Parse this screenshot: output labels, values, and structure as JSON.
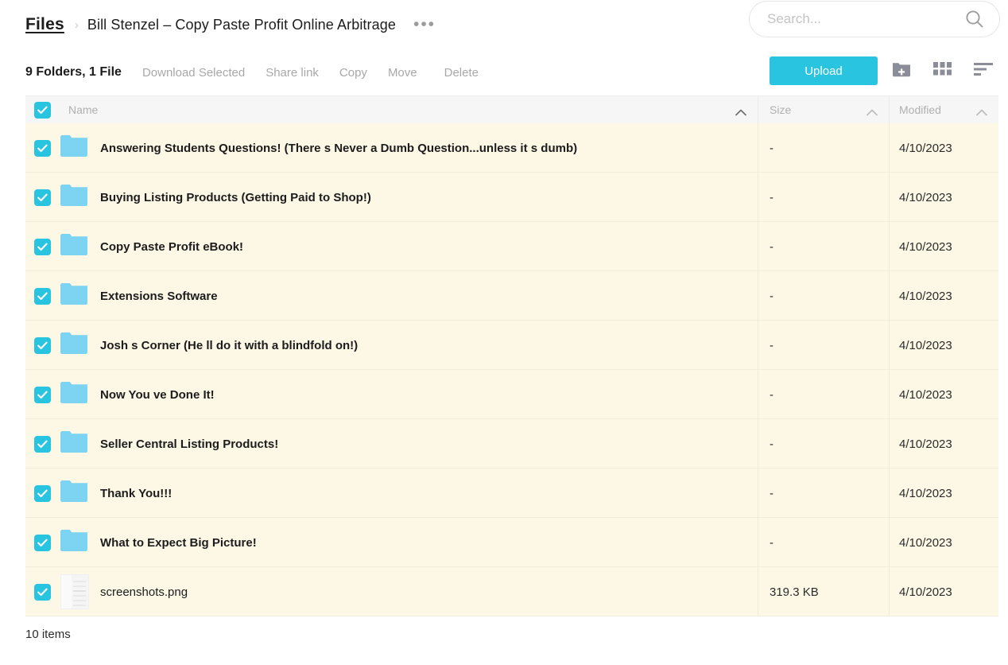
{
  "header": {
    "breadcrumb_root": "Files",
    "breadcrumb_separator": "›",
    "breadcrumb_current": "Bill Stenzel – Copy Paste Profit Online Arbitrage",
    "more_menu": "•••",
    "search_placeholder": "Search...",
    "search_value": ""
  },
  "toolbar": {
    "selection_summary": "9 Folders, 1 File",
    "actions": [
      {
        "label": "Download Selected",
        "name": "download-selected"
      },
      {
        "label": "Share link",
        "name": "share-link"
      },
      {
        "label": "Copy",
        "name": "copy"
      },
      {
        "label": "Move",
        "name": "move"
      },
      {
        "label": "Delete",
        "name": "delete"
      }
    ],
    "upload_label": "Upload",
    "accent_color": "#29c5e0",
    "new_folder_icon": "folder-plus-icon",
    "grid_view_icon": "grid-view-icon",
    "sort_icon": "sort-icon"
  },
  "table": {
    "select_all_checked": true,
    "columns": [
      {
        "label": "Name",
        "sorted": true
      },
      {
        "label": "Size",
        "sorted": false
      },
      {
        "label": "Modified",
        "sorted": false
      }
    ],
    "rows": [
      {
        "selected": true,
        "type": "folder",
        "name": "Answering Students Questions! (There s Never a Dumb Question...unless it s dumb)",
        "size": "-",
        "modified": "4/10/2023"
      },
      {
        "selected": true,
        "type": "folder",
        "name": "Buying Listing Products (Getting Paid to Shop!)",
        "size": "-",
        "modified": "4/10/2023"
      },
      {
        "selected": true,
        "type": "folder",
        "name": "Copy Paste Profit eBook!",
        "size": "-",
        "modified": "4/10/2023"
      },
      {
        "selected": true,
        "type": "folder",
        "name": "Extensions Software",
        "size": "-",
        "modified": "4/10/2023"
      },
      {
        "selected": true,
        "type": "folder",
        "name": "Josh s Corner (He ll do it with a blindfold on!)",
        "size": "-",
        "modified": "4/10/2023"
      },
      {
        "selected": true,
        "type": "folder",
        "name": "Now You ve Done It!",
        "size": "-",
        "modified": "4/10/2023"
      },
      {
        "selected": true,
        "type": "folder",
        "name": "Seller Central Listing Products!",
        "size": "-",
        "modified": "4/10/2023"
      },
      {
        "selected": true,
        "type": "folder",
        "name": "Thank You!!!",
        "size": "-",
        "modified": "4/10/2023"
      },
      {
        "selected": true,
        "type": "folder",
        "name": "What to Expect Big Picture!",
        "size": "-",
        "modified": "4/10/2023"
      },
      {
        "selected": true,
        "type": "image",
        "name": "screenshots.png",
        "size": "319.3 KB",
        "modified": "4/10/2023"
      }
    ]
  },
  "footer": {
    "item_count": "10 items"
  },
  "colors": {
    "accent": "#29c5e0",
    "row_selected_bg": "#fdf8e6",
    "folder_icon": "#7dd3f2",
    "header_bg": "#f6f6f6"
  }
}
